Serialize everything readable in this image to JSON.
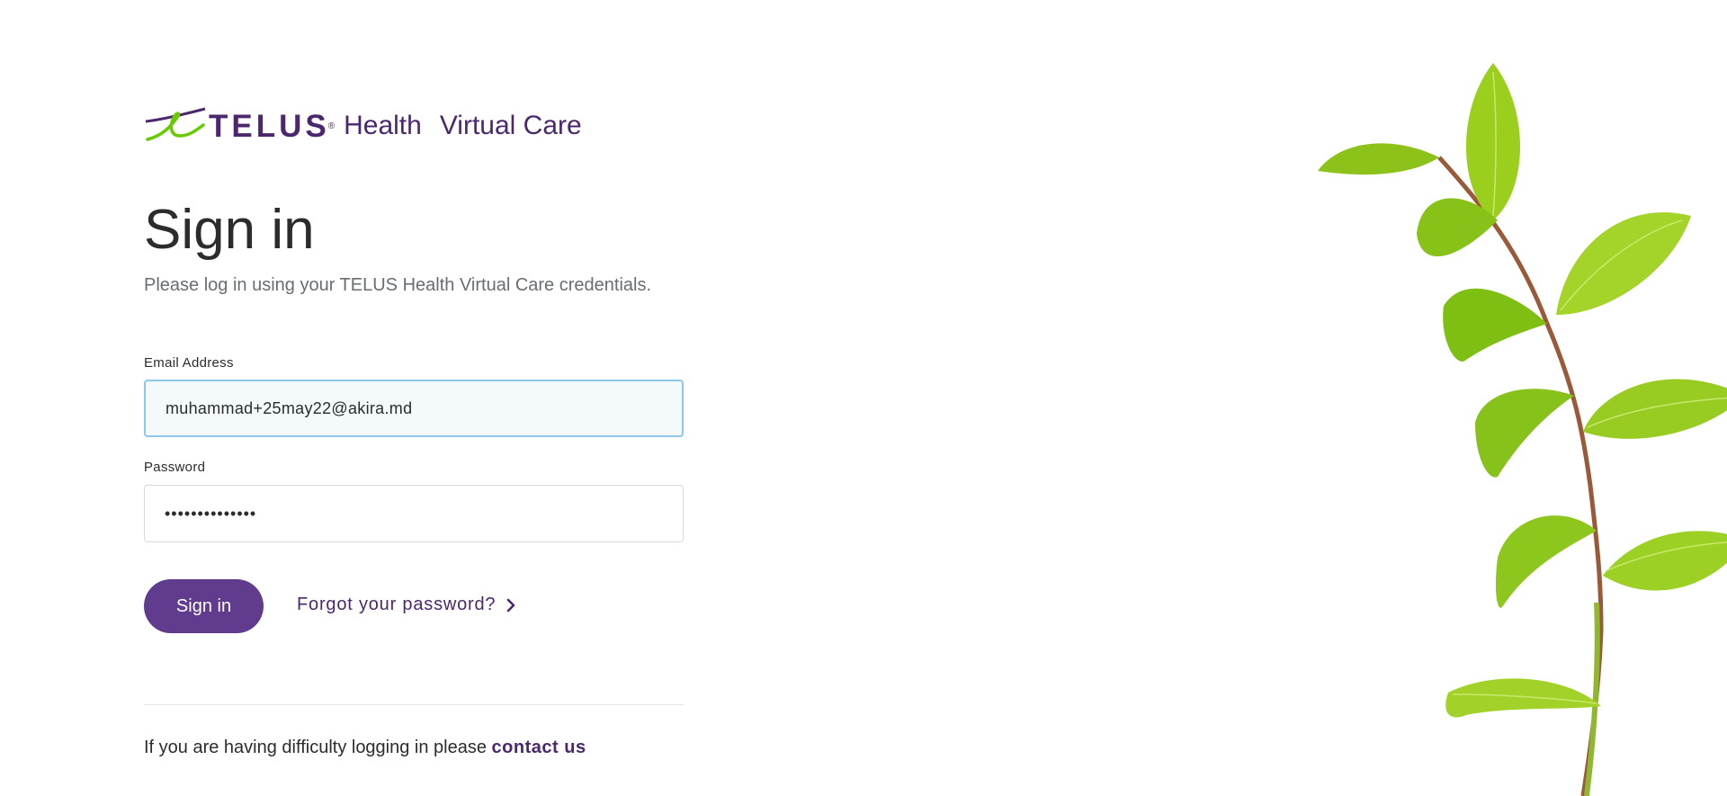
{
  "brand": {
    "wordmark": "TELUS",
    "registered_mark": "®",
    "health": "Health",
    "product": "Virtual Care",
    "primary_color": "#4b286d",
    "accent_green": "#66cc00"
  },
  "signin": {
    "title": "Sign in",
    "subtitle": "Please log in using your TELUS Health Virtual Care credentials.",
    "email_label": "Email Address",
    "email_value": "muhammad+25may22@akira.md",
    "password_label": "Password",
    "password_value": "••••••••••••••",
    "submit_label": "Sign in",
    "forgot_label": "Forgot your password?",
    "forgot_icon": "chevron-right-icon"
  },
  "help": {
    "text": "If you are having difficulty logging in please ",
    "link_label": "contact us"
  },
  "decor": {
    "image": "green-plant-leaves",
    "leaf_color": "#8ccc1a",
    "stem_color": "#9a5a3a"
  }
}
